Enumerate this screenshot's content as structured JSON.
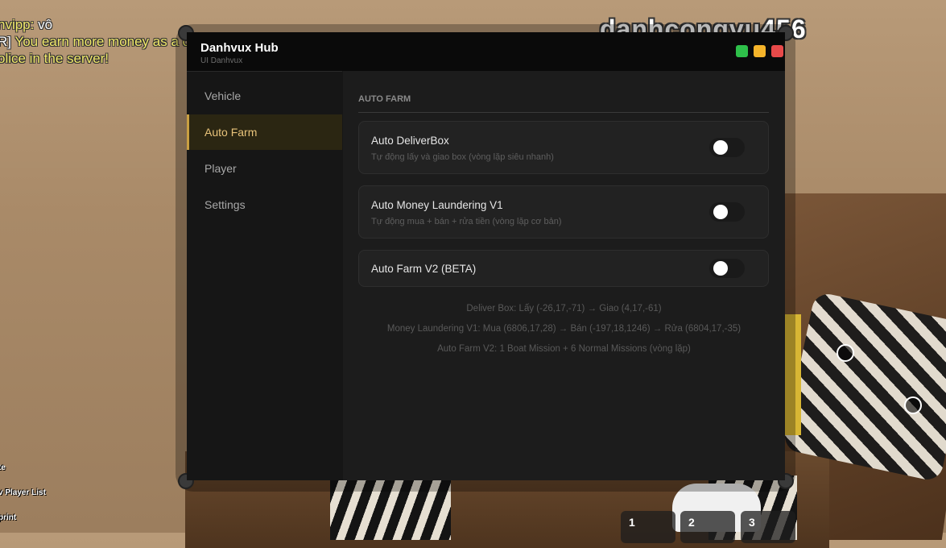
{
  "game": {
    "chat": {
      "line1_name": "nvipp:",
      "line1_msg": "vô",
      "line2_prefix": "R]",
      "line2_msg": "You earn more money as a civilian when there are",
      "line3_msg": "olice in the server!"
    },
    "overhead_name": "danhcongvu456",
    "side_menu": [
      "te",
      "v Player List",
      "print"
    ],
    "hotbar": [
      "1",
      "2",
      "3"
    ]
  },
  "window": {
    "title": "Danhvux Hub",
    "subtitle": "UI Danhvux",
    "controls": {
      "green": "#2ec04a",
      "yellow": "#f5b42a",
      "red": "#e84a4a"
    }
  },
  "sidebar": {
    "items": [
      {
        "label": "Vehicle"
      },
      {
        "label": "Auto Farm"
      },
      {
        "label": "Player"
      },
      {
        "label": "Settings"
      }
    ],
    "active": "Auto Farm"
  },
  "main": {
    "section_title": "AUTO FARM",
    "toggles": [
      {
        "title": "Auto DeliverBox",
        "desc": "Tự động lấy và giao box (vòng lặp siêu nhanh)",
        "on": false
      },
      {
        "title": "Auto Money Laundering V1",
        "desc": "Tự động mua + bán + rửa tiền (vòng lặp cơ bản)",
        "on": false
      },
      {
        "title": "Auto Farm V2 (BETA)",
        "desc": "",
        "on": false
      }
    ],
    "info": [
      "Deliver Box: Lấy (-26,17,-71) → Giao (4,17,-61)",
      "Money Laundering V1: Mua (6806,17,28) → Bán (-197,18,1246) → Rửa (6804,17,-35)",
      "Auto Farm V2: 1 Boat Mission + 6 Normal Missions (vòng lặp)"
    ]
  },
  "colors": {
    "accent": "#c9a042",
    "active_text": "#e8c37a"
  }
}
